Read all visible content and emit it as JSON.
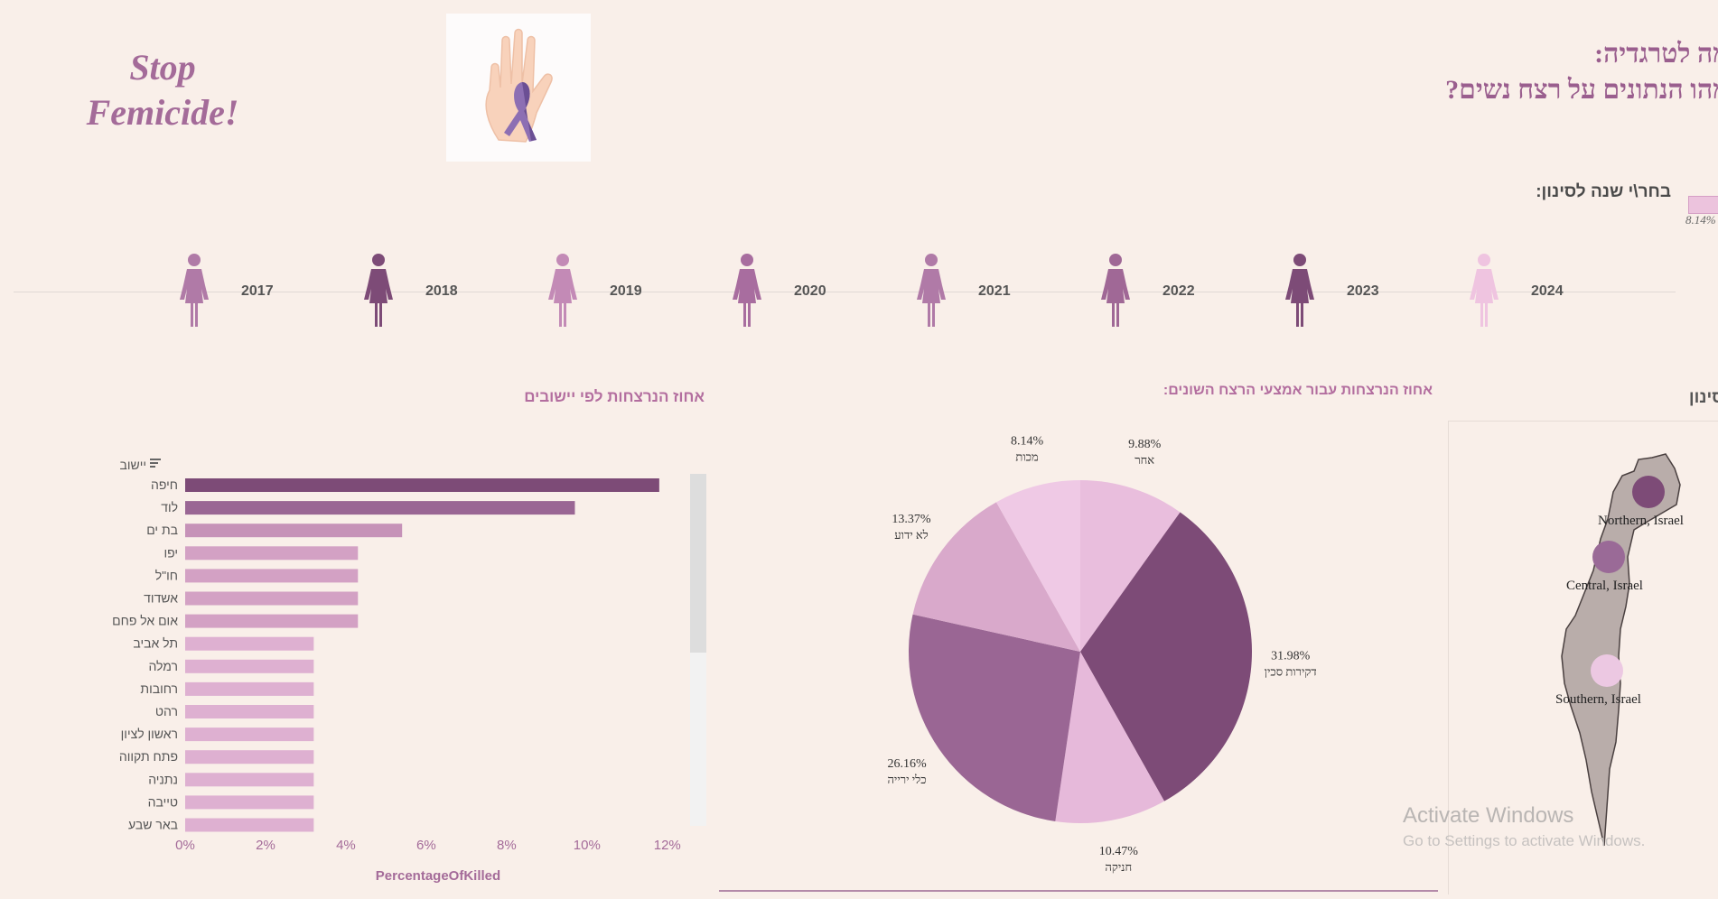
{
  "header": {
    "logo_line1": "Stop",
    "logo_line2": "Femicide!",
    "headline_line1": "מה לטרגדיה:",
    "headline_line2": "מהו הנתונים על רצח נשים?",
    "year_filter_label": "בחר\\י שנה לסינון:",
    "legend_value": "8.14%"
  },
  "years": [
    {
      "label": "2017",
      "color": "#b07aa7"
    },
    {
      "label": "2018",
      "color": "#7d4b77"
    },
    {
      "label": "2019",
      "color": "#c38ab6"
    },
    {
      "label": "2020",
      "color": "#a86d9f"
    },
    {
      "label": "2021",
      "color": "#b07aa7"
    },
    {
      "label": "2022",
      "color": "#a06896"
    },
    {
      "label": "2023",
      "color": "#7d4b77"
    },
    {
      "label": "2024",
      "color": "#efc4e0"
    }
  ],
  "bar_section": {
    "title": "אחוז הנרצחות לפי יישובים"
  },
  "pie_section": {
    "title": "אחוז הנרצחות עבור אמצעי הרצח השונים:"
  },
  "map_section": {
    "title": "י לסינון",
    "regions": [
      {
        "label": "Northern, Israel",
        "color": "#7d4b77"
      },
      {
        "label": "Central, Israel",
        "color": "#9a6a97"
      },
      {
        "label": "Southern, Israel",
        "color": "#ecc8e2"
      }
    ]
  },
  "watermark": {
    "line1": "Activate Windows",
    "line2": "Go to Settings to activate Windows."
  },
  "chart_data": [
    {
      "type": "bar",
      "orientation": "horizontal",
      "y_header": "יישוב",
      "xlabel": "PercentageOfKilled",
      "xlim": [
        0,
        12.5
      ],
      "x_ticks": [
        "0%",
        "2%",
        "4%",
        "6%",
        "8%",
        "10%",
        "12%"
      ],
      "x_tick_values": [
        0,
        2,
        4,
        6,
        8,
        10,
        12
      ],
      "categories": [
        "חיפה",
        "לוד",
        "בת ים",
        "יפו",
        "חו\"ל",
        "אשדוד",
        "אום אל פחם",
        "תל אביב",
        "רמלה",
        "רחובות",
        "רהט",
        "ראשון לציון",
        "פתח תקווה",
        "נתניה",
        "טייבה",
        "באר שבע"
      ],
      "values": [
        11.8,
        9.7,
        5.4,
        4.3,
        4.3,
        4.3,
        4.3,
        3.2,
        3.2,
        3.2,
        3.2,
        3.2,
        3.2,
        3.2,
        3.2,
        3.2
      ],
      "colors": [
        "#7d4b77",
        "#9a6694",
        "#c692b8",
        "#d3a1c4",
        "#d3a1c4",
        "#d3a1c4",
        "#d3a1c4",
        "#deb0d1",
        "#deb0d1",
        "#deb0d1",
        "#deb0d1",
        "#deb0d1",
        "#deb0d1",
        "#deb0d1",
        "#deb0d1",
        "#deb0d1"
      ]
    },
    {
      "type": "pie",
      "slices": [
        {
          "label": "אחר",
          "pct_text": "9.88%",
          "value": 9.88,
          "color": "#e9bedd"
        },
        {
          "label": "דקירות סכין",
          "pct_text": "31.98%",
          "value": 31.98,
          "color": "#7d4b77"
        },
        {
          "label": "חניקה",
          "pct_text": "10.47%",
          "value": 10.47,
          "color": "#e6b9da"
        },
        {
          "label": "כלי ירייה",
          "pct_text": "26.16%",
          "value": 26.16,
          "color": "#9a6694"
        },
        {
          "label": "לא ידוע",
          "pct_text": "13.37%",
          "value": 13.37,
          "color": "#d9a9cb"
        },
        {
          "label": "מכות",
          "pct_text": "8.14%",
          "value": 8.14,
          "color": "#efc9e5"
        }
      ]
    }
  ]
}
